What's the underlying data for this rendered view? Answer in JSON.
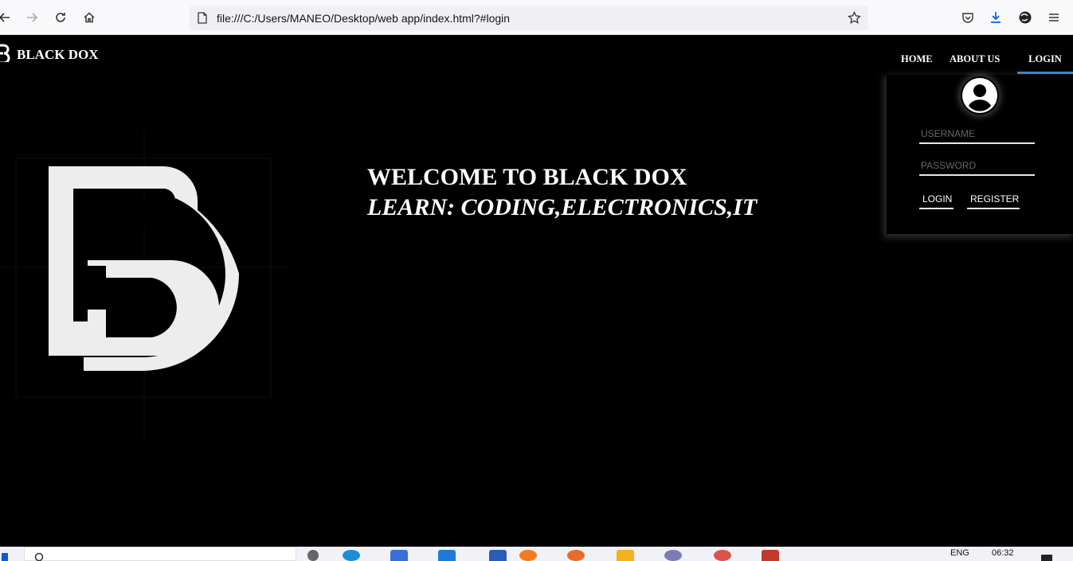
{
  "browser": {
    "url": "file:///C:/Users/MANEO/Desktop/web app/index.html?#login",
    "icons": [
      "back-icon",
      "forward-icon",
      "reload-icon",
      "home-icon",
      "page-icon",
      "bookmark-star-icon",
      "pocket-icon",
      "download-icon",
      "extension-icon",
      "menu-icon"
    ]
  },
  "site": {
    "brand": "BLACK DOX",
    "nav": {
      "home": "HOME",
      "about": "ABOUT US",
      "login": "LOGIN"
    },
    "hero": {
      "line1": "WELCOME TO BLACK DOX",
      "line2": "LEARN: CODING,ELECTRONICS,IT"
    },
    "login_panel": {
      "username_placeholder": "USERNAME",
      "password_placeholder": "PASSWORD",
      "login_button": "LOGIN",
      "register_button": "REGISTER"
    },
    "colors": {
      "background": "#000000",
      "accent": "#3a8fd1",
      "text": "#ffffff"
    }
  },
  "taskbar": {
    "lang": "ENG",
    "time": "06:32"
  }
}
